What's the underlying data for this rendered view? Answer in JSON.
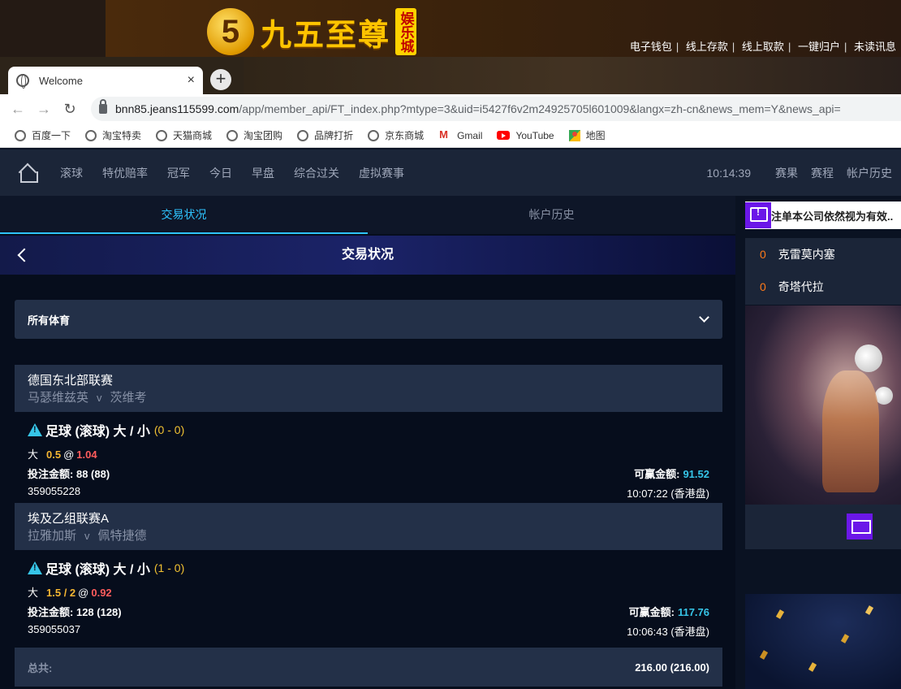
{
  "site": {
    "logo_text": "九五至尊",
    "logo_badge": "娱乐城",
    "top_links": [
      "电子钱包",
      "线上存款",
      "线上取款",
      "一键归户",
      "未读讯息"
    ]
  },
  "browser": {
    "tab_title": "Welcome",
    "tab_close": "×",
    "new_tab": "+",
    "url_host": "bnn85.jeans115599.com",
    "url_path": "/app/member_api/FT_index.php?mtype=3&uid=i5427f6v2m24925705l601009&langx=zh-cn&news_mem=Y&news_api=",
    "bookmarks": [
      {
        "label": "百度一下",
        "icon": "globe-icon"
      },
      {
        "label": "淘宝特卖",
        "icon": "globe-icon"
      },
      {
        "label": "天猫商城",
        "icon": "globe-icon"
      },
      {
        "label": "淘宝团购",
        "icon": "globe-icon"
      },
      {
        "label": "品牌打折",
        "icon": "globe-icon"
      },
      {
        "label": "京东商城",
        "icon": "globe-icon"
      },
      {
        "label": "Gmail",
        "icon": "gmail-icon"
      },
      {
        "label": "YouTube",
        "icon": "youtube-icon"
      },
      {
        "label": "地图",
        "icon": "maps-icon"
      }
    ]
  },
  "nav": {
    "items": [
      "滚球",
      "特优赔率",
      "冠军",
      "今日",
      "早盘",
      "综合过关",
      "虚拟赛事"
    ],
    "time": "10:14:39",
    "right_items": [
      "赛果",
      "赛程",
      "帐户历史"
    ]
  },
  "subtabs": [
    "交易状况",
    "帐户历史"
  ],
  "header_title": "交易状况",
  "filter": {
    "selected": "所有体育"
  },
  "bets": [
    {
      "league": "德国东北部联赛",
      "home": "马瑟维兹英",
      "vs": "v",
      "away": "茨维考",
      "market": "足球 (滚球) 大 / 小",
      "score": "(0 - 0)",
      "selection": "大",
      "handicap": "0.5",
      "at": "@",
      "odds": "1.04",
      "stake_label": "投注金额:",
      "stake": "88 (88)",
      "win_label": "可赢金额:",
      "win": "91.52",
      "ticket": "359055228",
      "time": "10:07:22 (香港盘)"
    },
    {
      "league": "埃及乙组联赛A",
      "home": "拉雅加斯",
      "vs": "v",
      "away": "佩特捷德",
      "market": "足球 (滚球) 大 / 小",
      "score": "(1 - 0)",
      "selection": "大",
      "handicap": "1.5 / 2",
      "at": "@",
      "odds": "0.92",
      "stake_label": "投注金额:",
      "stake": "128 (128)",
      "win_label": "可赢金额:",
      "win": "117.76",
      "ticket": "359055037",
      "time": "10:06:43 (香港盘)"
    }
  ],
  "total": {
    "label": "总共:",
    "value": "216.00 (216.00)"
  },
  "side": {
    "marquee": "注单本公司依然视为有效..",
    "list": [
      {
        "num": "0",
        "name": "克雷莫内塞"
      },
      {
        "num": "0",
        "name": "奇塔代拉"
      }
    ]
  },
  "colors": {
    "accent": "#2ec4ff",
    "odds": "#ff5c5c",
    "handicap": "#f5b632",
    "score": "#f1c232",
    "purple": "#6b17e8"
  }
}
